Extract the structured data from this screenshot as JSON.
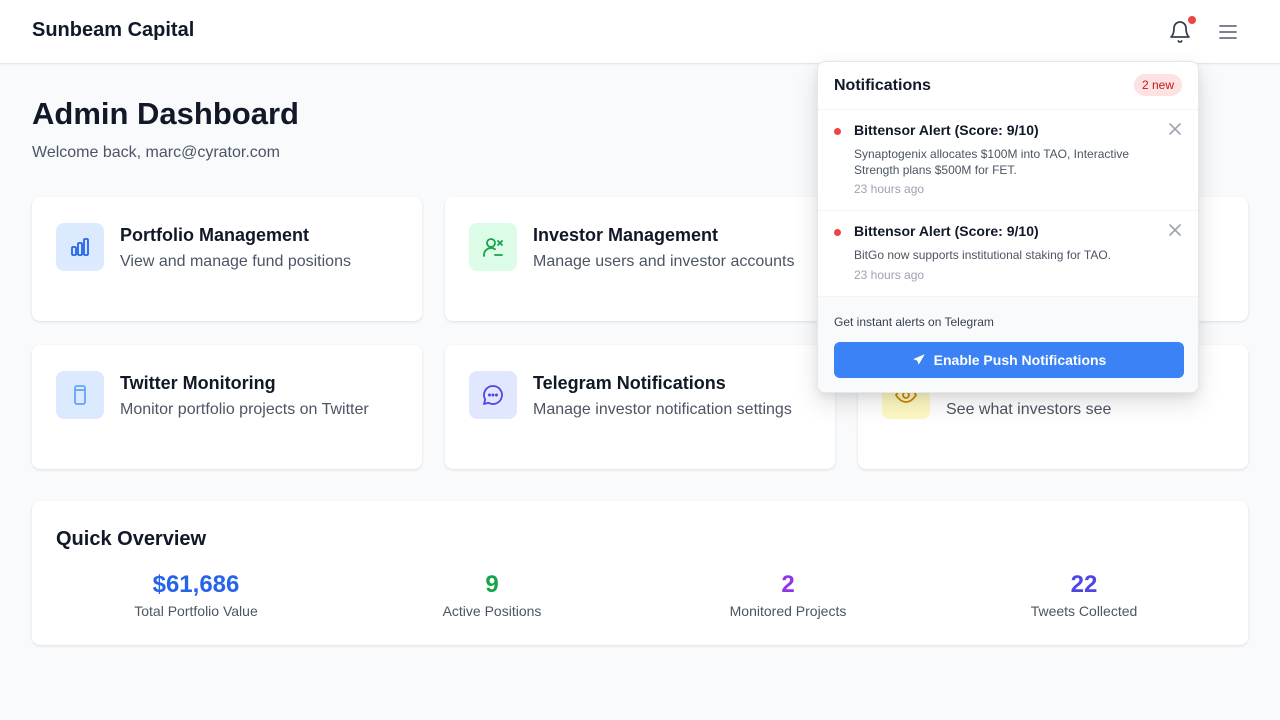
{
  "header": {
    "brand": "Sunbeam Capital",
    "notification_icon": "bell-icon",
    "menu_icon": "hamburger-menu-icon"
  },
  "page": {
    "title": "Admin Dashboard",
    "welcome": "Welcome back, marc@cyrator.com"
  },
  "cards": [
    {
      "title": "Portfolio Management",
      "desc": "View and manage fund positions",
      "icon": "bar-chart-icon",
      "icon_bg": "#dbeafe",
      "icon_color": "#2563eb"
    },
    {
      "title": "Investor Management",
      "desc": "Manage users and investor accounts",
      "icon": "user-manage-icon",
      "icon_bg": "#dcfce7",
      "icon_color": "#16a34a"
    },
    {
      "title": "Twitter Monitoring",
      "desc": "Monitor portfolio projects on Twitter",
      "icon": "phone-icon",
      "icon_bg": "#dbeafe",
      "icon_color": "#60a5fa"
    },
    {
      "title": "Telegram Notifications",
      "desc": "Manage investor notification settings",
      "icon": "chat-bubble-icon",
      "icon_bg": "#e0e7ff",
      "icon_color": "#4f46e5"
    },
    {
      "desc": "See what investors see",
      "icon": "eye-icon",
      "icon_bg": "#fef9c3",
      "icon_color": "#ca8a04"
    }
  ],
  "overview": {
    "title": "Quick Overview",
    "stats": [
      {
        "value": "$61,686",
        "label": "Total Portfolio Value",
        "color": "#2563eb"
      },
      {
        "value": "9",
        "label": "Active Positions",
        "color": "#16a34a"
      },
      {
        "value": "2",
        "label": "Monitored Projects",
        "color": "#9333ea"
      },
      {
        "value": "22",
        "label": "Tweets Collected",
        "color": "#4f46e5"
      }
    ]
  },
  "notifications": {
    "title": "Notifications",
    "badge": "2 new",
    "items": [
      {
        "title": "Bittensor Alert (Score: 9/10)",
        "body": "Synaptogenix allocates $100M into TAO, Interactive Strength plans $500M for FET.",
        "time": "23 hours ago"
      },
      {
        "title": "Bittensor Alert (Score: 9/10)",
        "body": "BitGo now supports institutional staking for TAO.",
        "time": "23 hours ago"
      }
    ],
    "footer_text": "Get instant alerts on Telegram",
    "button_label": "Enable Push Notifications",
    "button_icon": "telegram-send-icon"
  }
}
